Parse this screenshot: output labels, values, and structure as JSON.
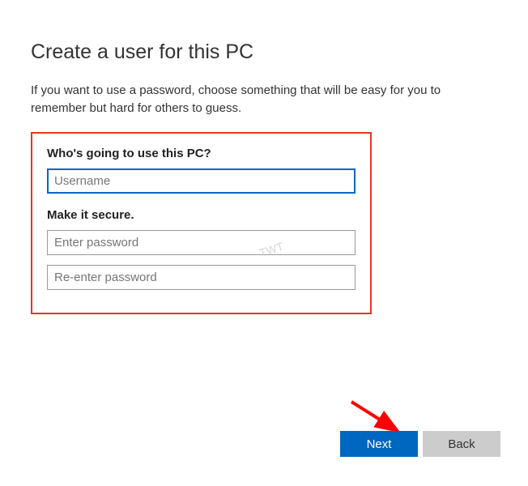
{
  "page": {
    "title": "Create a user for this PC",
    "subtitle": "If you want to use a password, choose something that will be easy for you to remember but hard for others to guess."
  },
  "form": {
    "username_section_label": "Who's going to use this PC?",
    "username_placeholder": "Username",
    "username_value": "",
    "secure_section_label": "Make it secure.",
    "password_placeholder": "Enter password",
    "password_value": "",
    "confirm_password_placeholder": "Re-enter password",
    "confirm_password_value": ""
  },
  "footer": {
    "next_label": "Next",
    "back_label": "Back"
  },
  "annotations": {
    "watermark": "TWT",
    "highlight_color": "#e83423",
    "arrow_color": "#ff0000"
  }
}
